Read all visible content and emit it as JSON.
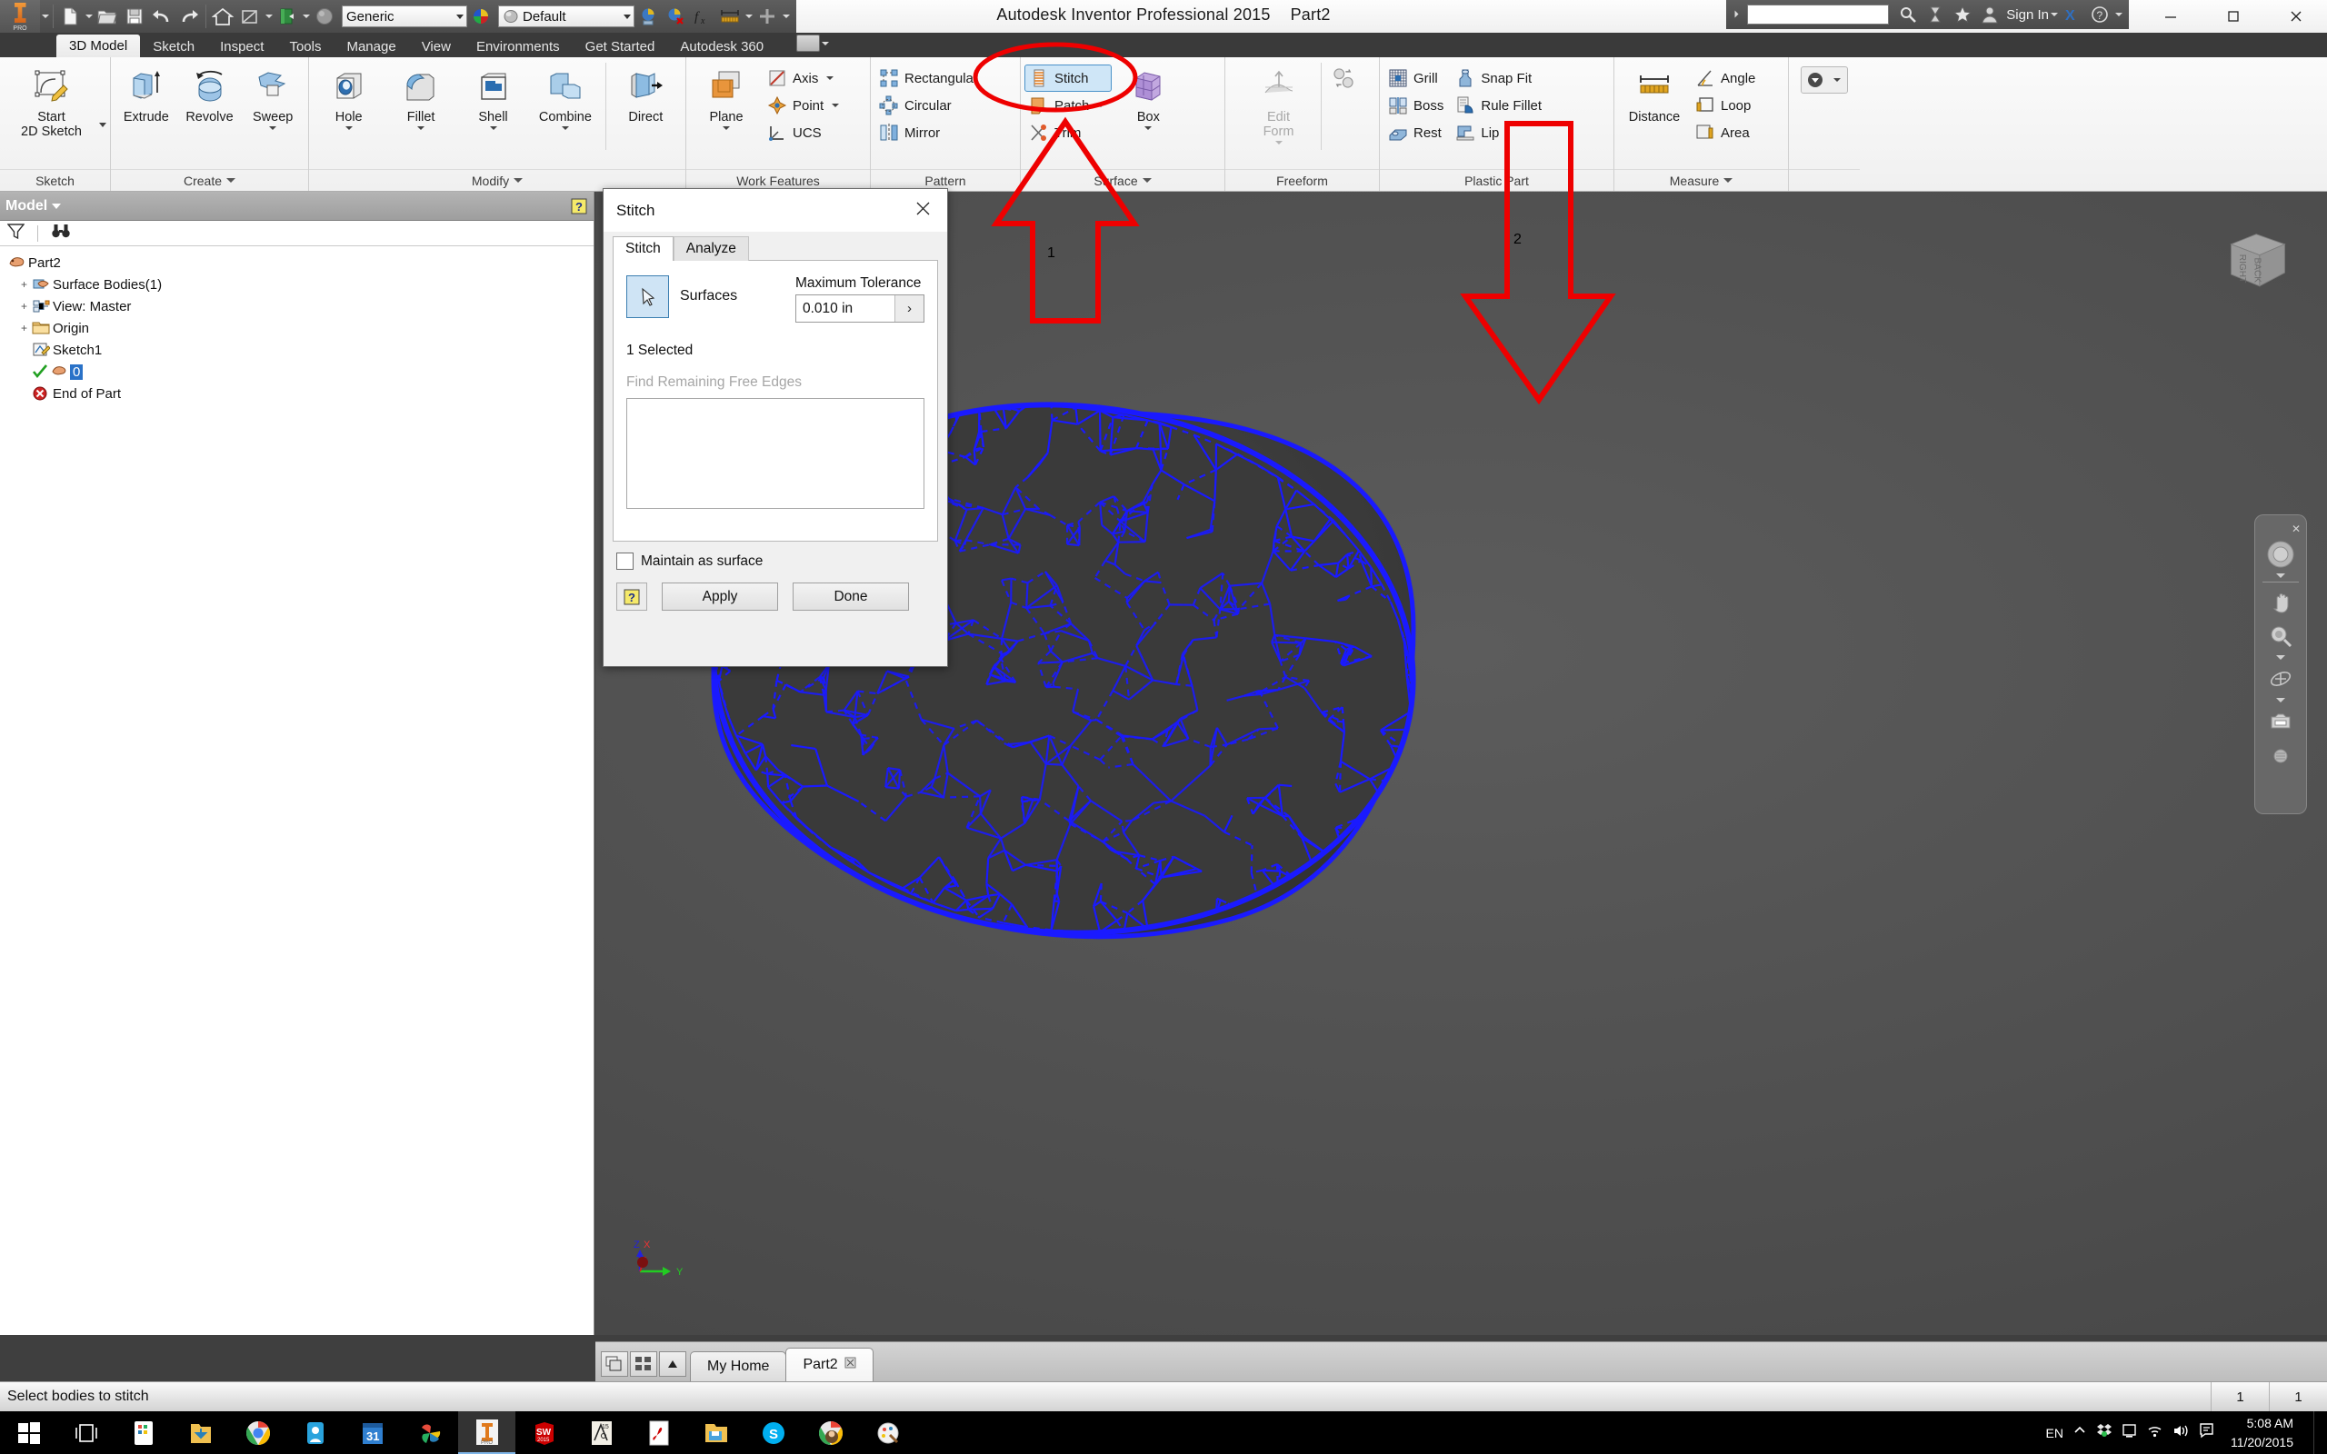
{
  "titlebar": {
    "app_title": "Autodesk Inventor Professional 2015",
    "document_name": "Part2",
    "material": "Generic",
    "appearance": "Default",
    "sign_in": "Sign In",
    "search_placeholder": "",
    "quick_access": [
      {
        "name": "new-file",
        "label": "New"
      },
      {
        "name": "open-file",
        "label": "Open"
      },
      {
        "name": "save",
        "label": "Save"
      },
      {
        "name": "undo",
        "label": "Undo"
      },
      {
        "name": "redo",
        "label": "Redo"
      },
      {
        "name": "home",
        "label": "Home"
      },
      {
        "name": "return",
        "label": "Return"
      },
      {
        "name": "update",
        "label": "Update"
      },
      {
        "name": "material-browser",
        "label": "Material Browser"
      }
    ],
    "window_buttons": [
      "minimize",
      "restore",
      "close"
    ]
  },
  "tabs": [
    {
      "label": "3D Model",
      "active": true
    },
    {
      "label": "Sketch",
      "active": false
    },
    {
      "label": "Inspect",
      "active": false
    },
    {
      "label": "Tools",
      "active": false
    },
    {
      "label": "Manage",
      "active": false
    },
    {
      "label": "View",
      "active": false
    },
    {
      "label": "Environments",
      "active": false
    },
    {
      "label": "Get Started",
      "active": false
    },
    {
      "label": "Autodesk 360",
      "active": false
    }
  ],
  "ribbon": {
    "panels": [
      {
        "title": "Sketch",
        "has_dropdown": false,
        "big": [
          {
            "label": "Start\n2D Sketch",
            "icon": "start-2d-sketch-icon",
            "dropdown": true,
            "disabled": false
          }
        ]
      },
      {
        "title": "Create",
        "has_dropdown": true,
        "big": [
          {
            "label": "Extrude",
            "icon": "extrude-icon",
            "dropdown": false,
            "disabled": false
          },
          {
            "label": "Revolve",
            "icon": "revolve-icon",
            "dropdown": false,
            "disabled": false
          },
          {
            "label": "Sweep",
            "icon": "sweep-icon",
            "dropdown": true,
            "disabled": false
          }
        ]
      },
      {
        "title": "Modify",
        "has_dropdown": true,
        "big": [
          {
            "label": "Hole",
            "icon": "hole-icon",
            "dropdown": true,
            "disabled": false
          },
          {
            "label": "Fillet",
            "icon": "fillet-icon",
            "dropdown": true,
            "disabled": false
          },
          {
            "label": "Shell",
            "icon": "shell-icon",
            "dropdown": true,
            "disabled": false
          },
          {
            "label": "Combine",
            "icon": "combine-icon",
            "dropdown": true,
            "disabled": false
          },
          {
            "label": "Direct",
            "icon": "direct-icon",
            "dropdown": false,
            "disabled": false
          }
        ]
      },
      {
        "title": "Work Features",
        "has_dropdown": false,
        "big": [
          {
            "label": "Plane",
            "icon": "plane-icon",
            "dropdown": true,
            "disabled": false
          }
        ],
        "small": [
          {
            "label": "Axis",
            "icon": "axis-icon",
            "dropdown": true
          },
          {
            "label": "Point",
            "icon": "point-icon",
            "dropdown": true
          },
          {
            "label": "UCS",
            "icon": "ucs-icon",
            "dropdown": false
          }
        ]
      },
      {
        "title": "Pattern",
        "has_dropdown": false,
        "small": [
          {
            "label": "Rectangular",
            "icon": "rectangular-pattern-icon",
            "dropdown": false
          },
          {
            "label": "Circular",
            "icon": "circular-pattern-icon",
            "dropdown": false
          },
          {
            "label": "Mirror",
            "icon": "mirror-icon",
            "dropdown": false
          }
        ]
      },
      {
        "title": "Surface",
        "has_dropdown": true,
        "small": [
          {
            "label": "Stitch",
            "icon": "stitch-icon",
            "dropdown": false,
            "selected": true
          },
          {
            "label": "Patch",
            "icon": "patch-icon",
            "dropdown": true
          },
          {
            "label": "Trim",
            "icon": "trim-icon",
            "dropdown": false
          }
        ],
        "big": [
          {
            "label": "Box",
            "icon": "box-icon",
            "dropdown": true,
            "disabled": false
          }
        ]
      },
      {
        "title": "Freeform",
        "has_dropdown": false,
        "big": [
          {
            "label": "Edit\nForm",
            "icon": "edit-form-icon",
            "dropdown": true,
            "disabled": true
          }
        ],
        "extra_icon": "freeform-convert-icon"
      },
      {
        "title": "Plastic Part",
        "has_dropdown": false,
        "small": [
          {
            "label": "Grill",
            "icon": "grill-icon",
            "dropdown": false
          },
          {
            "label": "Boss",
            "icon": "boss-icon",
            "dropdown": false
          },
          {
            "label": "Rest",
            "icon": "rest-icon",
            "dropdown": false
          },
          {
            "label": "Snap Fit",
            "icon": "snap-fit-icon",
            "dropdown": false
          },
          {
            "label": "Rule Fillet",
            "icon": "rule-fillet-icon",
            "dropdown": false
          },
          {
            "label": "Lip",
            "icon": "lip-icon",
            "dropdown": false
          }
        ]
      },
      {
        "title": "Measure",
        "has_dropdown": true,
        "big": [
          {
            "label": "Distance",
            "icon": "distance-icon",
            "dropdown": false,
            "disabled": false
          }
        ],
        "small": [
          {
            "label": "Angle",
            "icon": "angle-icon",
            "dropdown": false
          },
          {
            "label": "Loop",
            "icon": "loop-icon",
            "dropdown": false
          },
          {
            "label": "Area",
            "icon": "area-icon",
            "dropdown": false
          }
        ]
      }
    ]
  },
  "browser": {
    "title": "Model",
    "filter_icon": "filter-icon",
    "find_icon": "binoculars-icon",
    "help_icon": "help-icon",
    "tree": [
      {
        "label": "Part2",
        "icon": "part-icon",
        "indent": 0,
        "expander": ""
      },
      {
        "label": "Surface Bodies(1)",
        "icon": "surface-bodies-icon",
        "indent": 1,
        "expander": "+"
      },
      {
        "label": "View: Master",
        "icon": "view-master-icon",
        "indent": 1,
        "expander": "+"
      },
      {
        "label": "Origin",
        "icon": "folder-icon",
        "indent": 1,
        "expander": "+"
      },
      {
        "label": "Sketch1",
        "icon": "sketch-icon",
        "indent": 1,
        "expander": ""
      },
      {
        "label": "0",
        "icon": "check-surface-icon",
        "indent": 1,
        "expander": "",
        "highlighted": true
      },
      {
        "label": "End of Part",
        "icon": "end-of-part-icon",
        "indent": 1,
        "expander": ""
      }
    ]
  },
  "dialog": {
    "title": "Stitch",
    "close_icon": "close-icon",
    "tabs": [
      {
        "label": "Stitch",
        "active": true
      },
      {
        "label": "Analyze",
        "active": false
      }
    ],
    "select_button_icon": "cursor-select-icon",
    "surfaces_label": "Surfaces",
    "tolerance_label": "Maximum Tolerance",
    "tolerance_value": "0.010 in",
    "tolerance_arrow": "›",
    "selected_count": "1 Selected",
    "find_free_edges_label": "Find Remaining Free Edges",
    "maintain_as_surface_label": "Maintain as surface",
    "maintain_as_surface_checked": false,
    "help_icon": "help-icon",
    "apply_label": "Apply",
    "done_label": "Done"
  },
  "annotations": [
    {
      "id": "1",
      "label": "1",
      "shape": "arrow-up-with-ellipse",
      "color": "#ee0000",
      "target": "Stitch ribbon button"
    },
    {
      "id": "2",
      "label": "2",
      "shape": "arrow-down",
      "color": "#ee0000",
      "target": "3D mesh body"
    }
  ],
  "viewport": {
    "viewcube_faces": [
      "RIGHT",
      "BACK"
    ],
    "axis_labels": [
      "Z",
      "X",
      "Y"
    ],
    "axis_colors": {
      "x": "#dd2222",
      "y": "#22cc22",
      "z": "#2222dd"
    },
    "mesh_color": "#1a1aff",
    "body_color": "#3a3a3a",
    "navbar_items": [
      "steering-wheel-icon",
      "pan-icon",
      "zoom-icon",
      "orbit-icon",
      "look-at-icon"
    ]
  },
  "doctabs": {
    "buttons": [
      "cascade-windows-icon",
      "tile-windows-icon",
      "scroll-up-icon"
    ],
    "tabs": [
      {
        "label": "My Home",
        "active": false,
        "closable": false
      },
      {
        "label": "Part2",
        "active": true,
        "closable": true
      }
    ]
  },
  "statusbar": {
    "message": "Select bodies to stitch",
    "cells": [
      "1",
      "1"
    ]
  },
  "taskbar": {
    "items": [
      {
        "name": "start-button",
        "icon": "windows-logo-icon"
      },
      {
        "name": "task-view-button",
        "icon": "task-view-icon"
      },
      {
        "name": "store-app",
        "icon": "store-icon"
      },
      {
        "name": "downloads-app",
        "icon": "download-folder-icon"
      },
      {
        "name": "chrome-app",
        "icon": "chrome-icon"
      },
      {
        "name": "media-app",
        "icon": "media-icon"
      },
      {
        "name": "calendar-app",
        "icon": "calendar-31-icon"
      },
      {
        "name": "photos-app",
        "icon": "photos-pinwheel-icon"
      },
      {
        "name": "inventor-app",
        "icon": "inventor-icon",
        "active": true
      },
      {
        "name": "solidworks-app",
        "icon": "solidworks-2015-icon"
      },
      {
        "name": "autocad-app",
        "icon": "autocad-15-icon"
      },
      {
        "name": "acrobat-app",
        "icon": "acrobat-icon"
      },
      {
        "name": "explorer-app",
        "icon": "folder-icon"
      },
      {
        "name": "skype-app",
        "icon": "skype-icon"
      },
      {
        "name": "chrome2-app",
        "icon": "chrome-profile-icon"
      },
      {
        "name": "paint-app",
        "icon": "paint-icon"
      }
    ],
    "tray": {
      "language": "EN",
      "icons": [
        "show-hidden-icon",
        "dropbox-icon",
        "display-icon",
        "wifi-icon",
        "volume-icon",
        "action-center-icon"
      ],
      "time": "5:08 AM",
      "date": "11/20/2015"
    }
  }
}
